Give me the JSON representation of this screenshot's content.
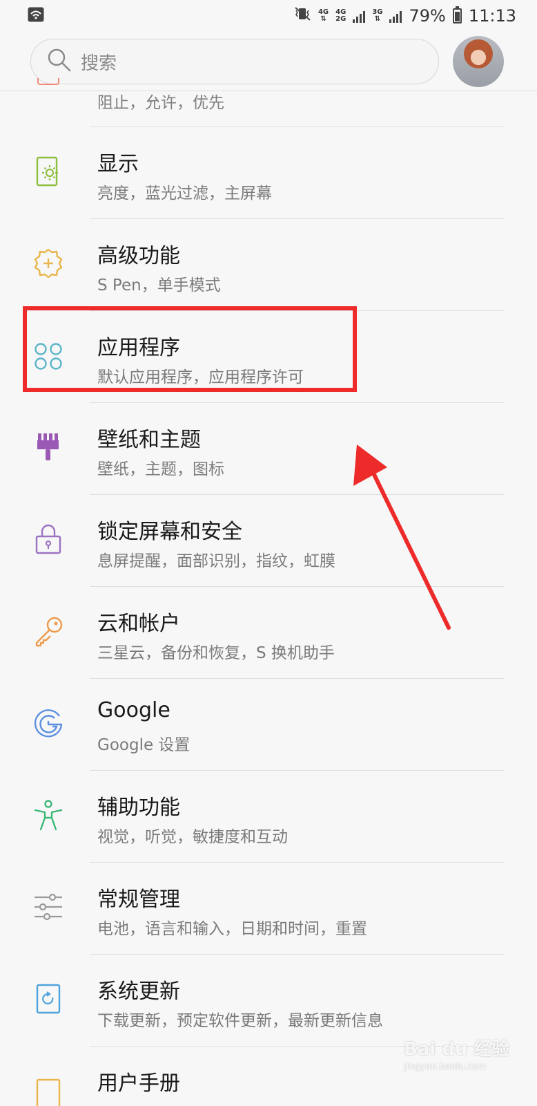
{
  "status_bar": {
    "wifi_icon": "wifi-icon",
    "mute_icon": "vibrate-mute-icon",
    "net1": "4G",
    "net2_top": "4G",
    "net2_bottom": "2G",
    "net3": "3G",
    "battery": "79%",
    "time": "11:13"
  },
  "search": {
    "icon": "search-icon",
    "placeholder": "搜索"
  },
  "settings": {
    "partial_subtitle": "阻止，允许，优先",
    "items": [
      {
        "title": "显示",
        "subtitle": "亮度，蓝光过滤，主屏幕",
        "icon": "display-icon",
        "color": "#8cbf3f"
      },
      {
        "title": "高级功能",
        "subtitle": "S Pen，单手模式",
        "icon": "advanced-features-icon",
        "color": "#e9b54a"
      },
      {
        "title": "应用程序",
        "subtitle": "默认应用程序，应用程序许可",
        "icon": "apps-icon",
        "color": "#5bb4c8"
      },
      {
        "title": "壁纸和主题",
        "subtitle": "壁纸，主题，图标",
        "icon": "wallpaper-brush-icon",
        "color": "#9b59b6"
      },
      {
        "title": "锁定屏幕和安全",
        "subtitle": "息屏提醒，面部识别，指纹，虹膜",
        "icon": "lock-icon",
        "color": "#9a72c2"
      },
      {
        "title": "云和帐户",
        "subtitle": "三星云，备份和恢复，S 换机助手",
        "icon": "key-icon",
        "color": "#ef9a4b"
      },
      {
        "title": "Google",
        "subtitle": "Google 设置",
        "icon": "google-icon",
        "color": "#5b8fe0"
      },
      {
        "title": "辅助功能",
        "subtitle": "视觉，听觉，敏捷度和互动",
        "icon": "accessibility-icon",
        "color": "#3cb878"
      },
      {
        "title": "常规管理",
        "subtitle": "电池，语言和输入，日期和时间，重置",
        "icon": "sliders-icon",
        "color": "#9a9a9a"
      },
      {
        "title": "系统更新",
        "subtitle": "下载更新，预定软件更新，最新更新信息",
        "icon": "system-update-icon",
        "color": "#4da3dd"
      },
      {
        "title": "用户手册",
        "subtitle": "",
        "icon": "user-manual-icon",
        "color": "#e8b64a"
      }
    ]
  },
  "annotation": {
    "highlight_color": "#ee2b2b"
  },
  "watermark": {
    "main": "Bai du 经验",
    "sub": "jingyan.baidu.com"
  }
}
